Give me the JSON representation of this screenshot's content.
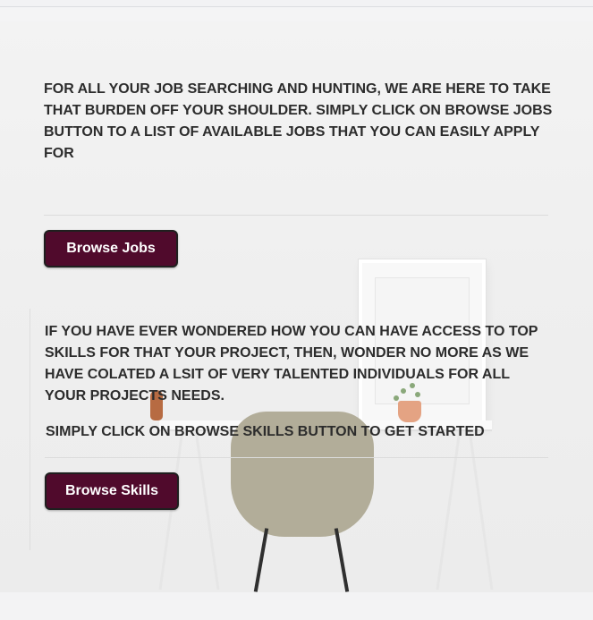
{
  "intro": {
    "jobs_text": "FOR ALL YOUR JOB SEARCHING AND HUNTING, WE ARE HERE TO TAKE THAT BURDEN OFF YOUR SHOULDER. SIMPLY CLICK ON BROWSE JOBS BUTTON TO A LIST OF AVAILABLE JOBS THAT YOU CAN EASILY APPLY FOR",
    "browse_jobs_label": "Browse Jobs"
  },
  "skills": {
    "skills_text": "IF YOU HAVE EVER WONDERED HOW YOU CAN HAVE ACCESS TO TOP SKILLS FOR THAT YOUR PROJECT, THEN, WONDER NO MORE AS WE HAVE COLATED A LSIT OF VERY TALENTED INDIVIDUALS FOR ALL YOUR PROJECTS NEEDS.",
    "cta_text": "SIMPLY CLICK ON BROWSE SKILLS BUTTON TO GET STARTED",
    "browse_skills_label": "Browse Skills"
  },
  "colors": {
    "button_bg": "#500a2c",
    "button_text": "#ffffff",
    "body_text": "#2c2c2c"
  }
}
